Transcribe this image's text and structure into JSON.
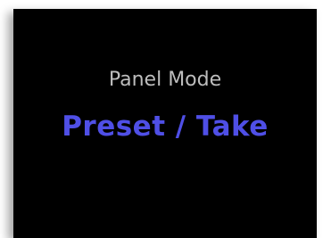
{
  "panel": {
    "label": "Panel Mode",
    "value": "Preset / Take",
    "colors": {
      "background": "#000000",
      "label": "#bdbdbd",
      "value": "#4f4fe6"
    }
  }
}
